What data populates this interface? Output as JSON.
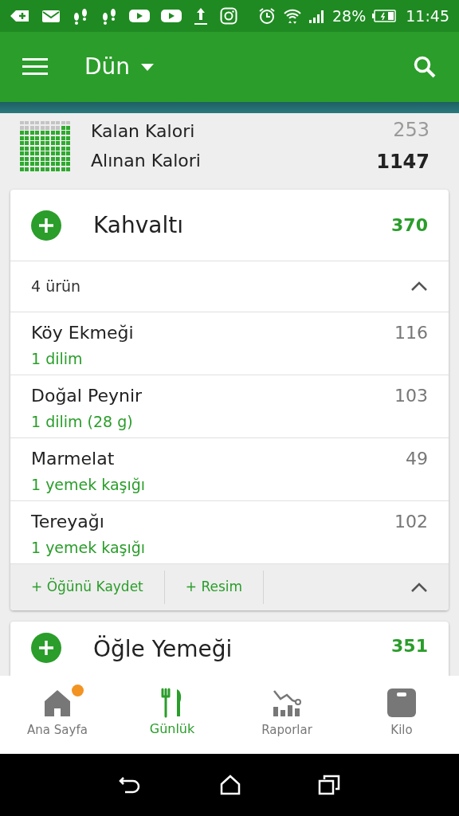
{
  "status_bar": {
    "battery": "28%",
    "time": "11:45"
  },
  "app_bar": {
    "title": "Dün"
  },
  "summary": {
    "rows": [
      {
        "label": "Kalan Kalori",
        "value": "253",
        "kind": "remaining"
      },
      {
        "label": "Alınan Kalori",
        "value": "1147",
        "kind": "taken"
      }
    ]
  },
  "meals": [
    {
      "title": "Kahvaltı",
      "calories": "370",
      "count": "4 ürün",
      "items": [
        {
          "name": "Köy Ekmeği",
          "portion": "1 dilim",
          "calories": "116"
        },
        {
          "name": "Doğal Peynir",
          "portion": "1 dilim (28 g)",
          "calories": "103"
        },
        {
          "name": "Marmelat",
          "portion": "1 yemek kaşığı",
          "calories": "49"
        },
        {
          "name": "Tereyağı",
          "portion": "1 yemek kaşığı",
          "calories": "102"
        }
      ],
      "actions": [
        "+ Öğünü Kaydet",
        "+ Resim"
      ]
    },
    {
      "title": "Öğle Yemeği",
      "calories": "351"
    }
  ],
  "bottom_nav": [
    {
      "label": "Ana Sayfa",
      "selected": false,
      "badge": true
    },
    {
      "label": "Günlük",
      "selected": true,
      "badge": false
    },
    {
      "label": "Raporlar",
      "selected": false,
      "badge": false
    },
    {
      "label": "Kilo",
      "selected": false,
      "badge": false
    }
  ]
}
